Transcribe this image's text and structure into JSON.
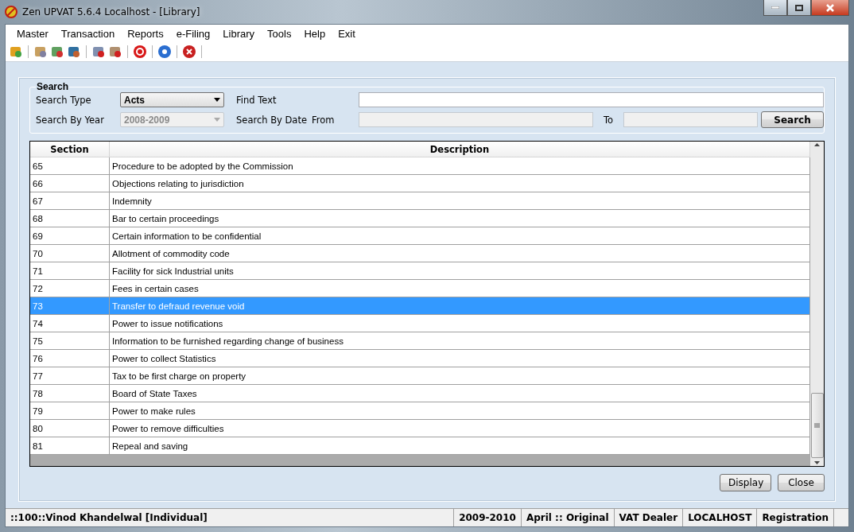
{
  "window": {
    "title": "Zen UPVAT 5.6.4 Localhost - [Library]"
  },
  "menu": [
    "Master",
    "Transaction",
    "Reports",
    "e-Filing",
    "Library",
    "Tools",
    "Help",
    "Exit"
  ],
  "search": {
    "title": "Search",
    "search_type": {
      "label": "Search Type",
      "value": "Acts"
    },
    "find_text": {
      "label": "Find Text"
    },
    "search_by_year": {
      "label": "Search By Year",
      "value": "2008-2009",
      "disabled": true
    },
    "search_by_date": {
      "label": "Search By Date",
      "from_label": "From",
      "to_label": "To",
      "disabled": true
    },
    "button": "Search"
  },
  "table": {
    "columns": [
      "Section",
      "Description"
    ],
    "rows": [
      {
        "section": "65",
        "description": "Procedure to be adopted by the Commission",
        "selected": false
      },
      {
        "section": "66",
        "description": "Objections relating to jurisdiction",
        "selected": false
      },
      {
        "section": "67",
        "description": "Indemnity",
        "selected": false
      },
      {
        "section": "68",
        "description": "Bar to certain proceedings",
        "selected": false
      },
      {
        "section": "69",
        "description": "Certain information to be confidential",
        "selected": false
      },
      {
        "section": "70",
        "description": "Allotment of commodity code",
        "selected": false
      },
      {
        "section": "71",
        "description": "Facility for sick Industrial units",
        "selected": false
      },
      {
        "section": "72",
        "description": "Fees in certain cases",
        "selected": false
      },
      {
        "section": "73",
        "description": "Transfer to defraud revenue void",
        "selected": true
      },
      {
        "section": "74",
        "description": "Power to issue notifications",
        "selected": false
      },
      {
        "section": "75",
        "description": "Information to be furnished regarding change of business",
        "selected": false
      },
      {
        "section": "76",
        "description": "Power to collect Statistics",
        "selected": false
      },
      {
        "section": "77",
        "description": "Tax to be first charge on property",
        "selected": false
      },
      {
        "section": "78",
        "description": "Board of State Taxes",
        "selected": false
      },
      {
        "section": "79",
        "description": "Power to make rules",
        "selected": false
      },
      {
        "section": "80",
        "description": "Power to remove difficulties",
        "selected": false
      },
      {
        "section": "81",
        "description": "Repeal and saving",
        "selected": false
      }
    ]
  },
  "buttons": [
    "Display",
    "Close"
  ],
  "status_bar": [
    "::100::Vinod Khandelwal [Individual]",
    "2009-2010",
    "April :: Original",
    "VAT Dealer",
    "LOCALHOST",
    "Registration"
  ]
}
